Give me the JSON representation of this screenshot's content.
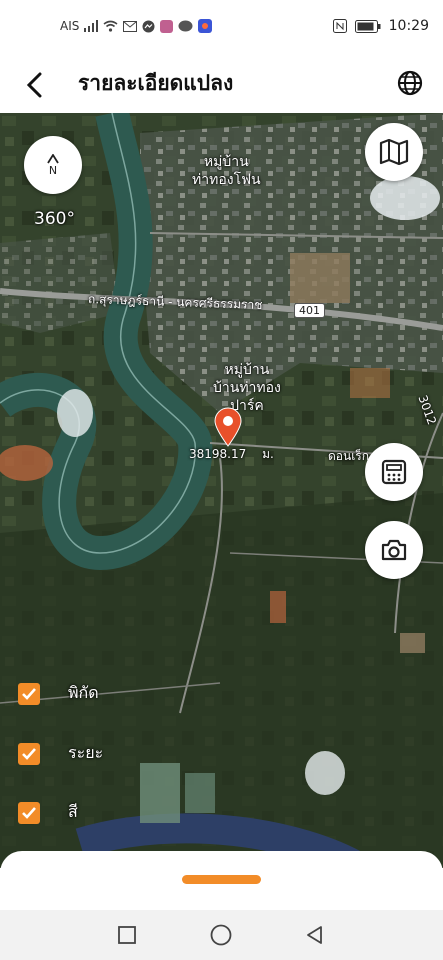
{
  "status_bar": {
    "carrier": "AIS",
    "time": "10:29",
    "icons": [
      "signal-icon",
      "wifi-icon",
      "mail-icon",
      "messenger-icon",
      "app-icon",
      "line-icon",
      "app-icon",
      "nfc-icon",
      "battery-icon"
    ]
  },
  "header": {
    "title": "รายละเอียดแปลง",
    "back_icon": "chevron-left-icon",
    "globe_icon": "globe-icon"
  },
  "map": {
    "compass_label": "N",
    "rotation_label": "360°",
    "place_labels": [
      {
        "text": "หมู่บ้าน\nท่าทองโฟน"
      },
      {
        "text": "หมู่บ้าน\nบ้านท่าทอง\nปาร์ค"
      }
    ],
    "road_label": "ถ.สุราษฎร์ธานี - นครศรีธรรมราช",
    "road_badge": "401",
    "road_right": "3012",
    "road_right2": "ดอนเร็ก",
    "marker_label": "38 198.17 ตร.ม.",
    "marker_left": "38",
    "marker_right": "198.17",
    "marker_unit": "ม.",
    "fab_icons": [
      "map-icon",
      "calculator-icon",
      "camera-icon"
    ]
  },
  "layers": [
    {
      "label": "พิกัด",
      "checked": true
    },
    {
      "label": "ระยะ",
      "checked": true
    },
    {
      "label": "สี",
      "checked": true
    }
  ],
  "colors": {
    "accent": "#f28c28",
    "pin": "#e8502a"
  }
}
